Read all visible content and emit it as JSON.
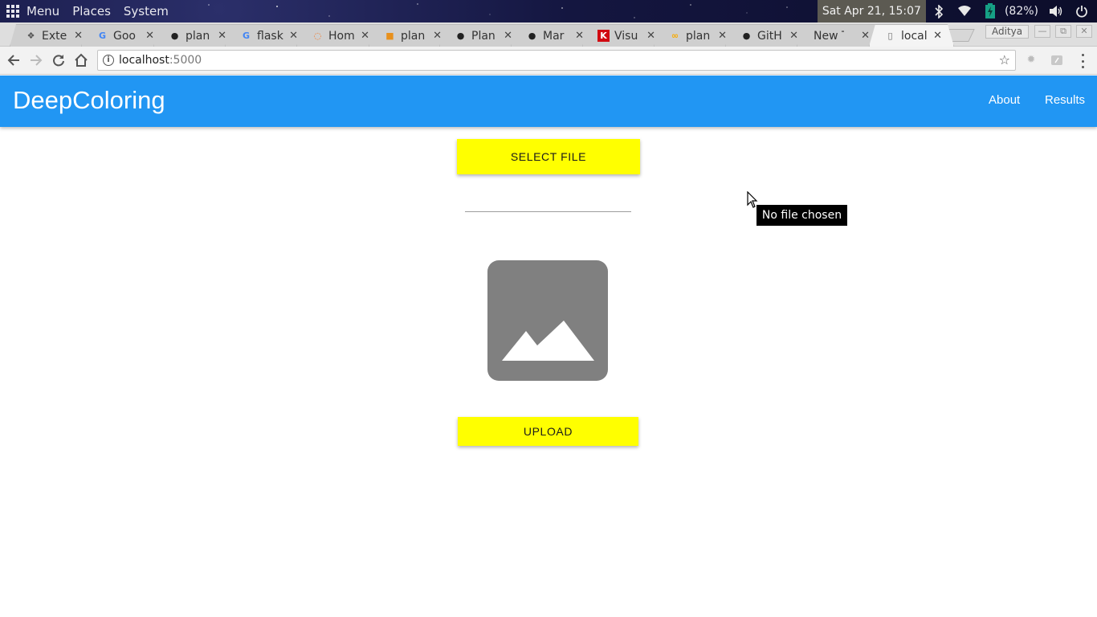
{
  "os_panel": {
    "menu_label": "Menu",
    "places_label": "Places",
    "system_label": "System",
    "clock": "Sat Apr 21, 15:07",
    "battery_percent": "(82%)",
    "icons": [
      "bluetooth-icon",
      "wifi-icon",
      "battery-icon",
      "volume-icon",
      "power-icon"
    ]
  },
  "browser": {
    "tabs": [
      {
        "label": "Exte",
        "favicon": "puzzle-icon",
        "active": false
      },
      {
        "label": "Goo",
        "favicon": "google-icon",
        "active": false
      },
      {
        "label": "plan",
        "favicon": "github-icon",
        "active": false
      },
      {
        "label": "flask",
        "favicon": "google-icon",
        "active": false
      },
      {
        "label": "Hom",
        "favicon": "jupyter-icon",
        "active": false
      },
      {
        "label": "plan",
        "favicon": "book-icon",
        "active": false
      },
      {
        "label": "Plan",
        "favicon": "github-icon",
        "active": false
      },
      {
        "label": "Mar",
        "favicon": "github-icon",
        "active": false
      },
      {
        "label": "Visu",
        "favicon": "k-icon",
        "active": false
      },
      {
        "label": "plan",
        "favicon": "colab-icon",
        "active": false
      },
      {
        "label": "GitH",
        "favicon": "github-icon",
        "active": false
      },
      {
        "label": "New Tal",
        "favicon": "",
        "active": false
      },
      {
        "label": "local",
        "favicon": "page-icon",
        "active": true
      }
    ],
    "profile_name": "Aditya",
    "url_host": "localhost",
    "url_port": ":5000"
  },
  "page": {
    "brand": "DeepColoring",
    "nav": {
      "about": "About",
      "results": "Results"
    },
    "select_file_label": "SELECT FILE",
    "upload_label": "UPLOAD",
    "tooltip": "No file chosen",
    "colors": {
      "appbar": "#2196f3",
      "button": "#ffff00",
      "placeholder": "#808080"
    }
  }
}
